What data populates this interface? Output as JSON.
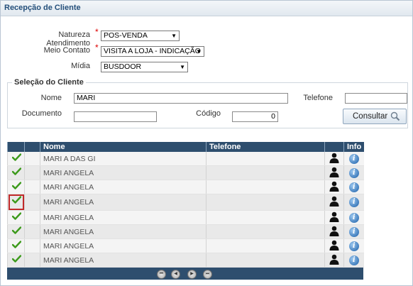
{
  "panel": {
    "title": "Recepção de Cliente"
  },
  "form": {
    "natureza_label": "Natureza Atendimento",
    "natureza_value": "POS-VENDA",
    "meio_label": "Meio Contato",
    "meio_value": "VISITA A LOJA - INDICAÇÃO",
    "midia_label": "Mídia",
    "midia_value": "BUSDOOR",
    "required_mark": "*"
  },
  "selecao": {
    "legend": "Seleção do Cliente",
    "nome_label": "Nome",
    "nome_value": "MARI",
    "telefone_label": "Telefone",
    "telefone_value": "",
    "documento_label": "Documento",
    "documento_value": "",
    "codigo_label": "Código",
    "codigo_value": "0",
    "consultar_label": "Consultar"
  },
  "grid": {
    "headers": {
      "nome": "Nome",
      "telefone": "Telefone",
      "info": "Info"
    },
    "rows": [
      {
        "nome": "MARI A DAS GI",
        "telefone": ""
      },
      {
        "nome": "MARI ANGELA",
        "telefone": ""
      },
      {
        "nome": "MARI ANGELA",
        "telefone": ""
      },
      {
        "nome": "MARI ANGELA",
        "telefone": ""
      },
      {
        "nome": "MARI ANGELA",
        "telefone": ""
      },
      {
        "nome": "MARI ANGELA",
        "telefone": ""
      },
      {
        "nome": "MARI ANGELA",
        "telefone": ""
      },
      {
        "nome": "MARI ANGELA",
        "telefone": ""
      }
    ],
    "selected_row": 4
  },
  "colors": {
    "header_bg": "#2e4e6e",
    "check": "#3c9a1b",
    "required": "#dd0000",
    "selection_border": "#c12a2a"
  }
}
